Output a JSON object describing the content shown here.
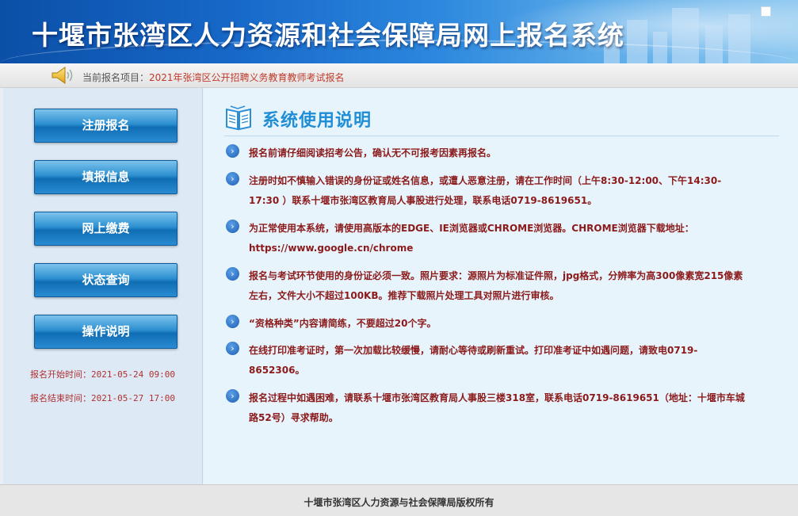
{
  "header": {
    "title": "十堰市张湾区人力资源和社会保障局网上报名系统"
  },
  "notice": {
    "label": "当前报名项目：",
    "project": "2021年张湾区公开招聘义务教育教师考试报名"
  },
  "sidebar": {
    "buttons": [
      {
        "label": "注册报名"
      },
      {
        "label": "填报信息"
      },
      {
        "label": "网上缴费"
      },
      {
        "label": "状态查询"
      },
      {
        "label": "操作说明"
      }
    ],
    "start_time": "报名开始时间：2021-05-24 09:00",
    "end_time": "报名结束时间：2021-05-27 17:00"
  },
  "main": {
    "title": "系统使用说明",
    "items": [
      {
        "text": "报名前请仔细阅读招考公告，确认无不可报考因素再报名。"
      },
      {
        "text": "注册时如不慎输入错误的身份证或姓名信息，或遭人恶意注册，请在工作时间（上午8:30-12:00、下午14:30-17:30 ）联系十堰市张湾区教育局人事股进行处理，联系电话0719-8619651。"
      },
      {
        "text": "为正常使用本系统，请使用高版本的EDGE、IE浏览器或CHROME浏览器。CHROME浏览器下载地址：https://www.google.cn/chrome"
      },
      {
        "text": "报名与考试环节使用的身份证必须一致。照片要求：源照片为标准证件照，jpg格式，分辨率为高300像素宽215像素左右，文件大小不超过100KB。推荐下载照片处理工具对照片进行审核。"
      },
      {
        "text": "“资格种类”内容请简练，不要超过20个字。"
      },
      {
        "text": "在线打印准考证时，第一次加载比较缓慢，请耐心等待或刷新重试。打印准考证中如遇问题，请致电0719-8652306。"
      },
      {
        "text": "报名过程中如遇困难，请联系十堰市张湾区教育局人事股三楼318室，联系电话0719-8619651（地址：十堰市车城路52号）寻求帮助。"
      }
    ]
  },
  "footer": {
    "copyright": "十堰市张湾区人力资源与社会保障局版权所有"
  },
  "icons": {
    "speaker": "speaker-icon",
    "book": "book-icon",
    "bullet": "chevron-right-icon"
  }
}
